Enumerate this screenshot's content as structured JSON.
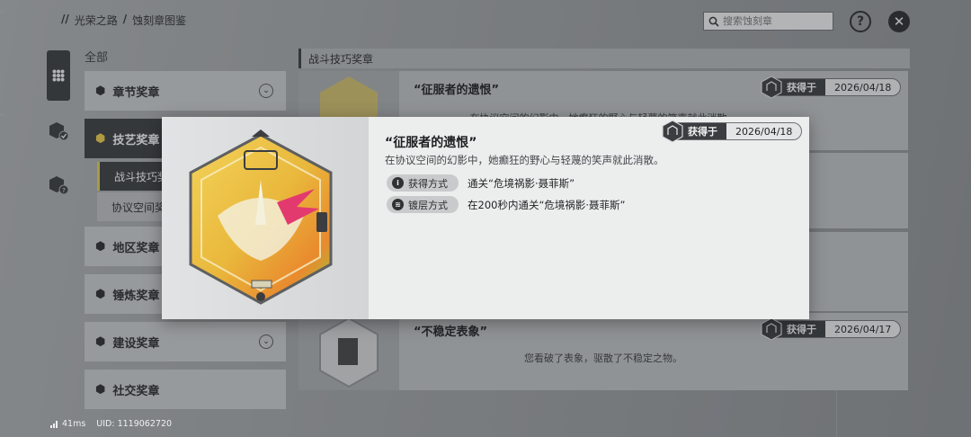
{
  "breadcrumb": {
    "prefix": "//",
    "root": "光荣之路",
    "separator": "/",
    "current": "蚀刻章图鉴"
  },
  "search": {
    "placeholder": "搜索蚀刻章"
  },
  "controls": {
    "help": "?",
    "close": "✕"
  },
  "categories": {
    "all_label": "全部",
    "items": [
      {
        "label": "章节奖章",
        "icon": "chapter-medal-icon",
        "active": false,
        "expandable": true
      },
      {
        "label": "技艺奖章",
        "icon": "skill-medal-icon",
        "active": true,
        "expandable": false
      },
      {
        "label": "地区奖章",
        "icon": "region-medal-icon",
        "active": false,
        "expandable": false
      },
      {
        "label": "锤炼奖章",
        "icon": "temper-medal-icon",
        "active": false,
        "expandable": false
      },
      {
        "label": "建设奖章",
        "icon": "build-medal-icon",
        "active": false,
        "expandable": true
      },
      {
        "label": "社交奖章",
        "icon": "social-medal-icon",
        "active": false,
        "expandable": false
      }
    ],
    "subitems": [
      {
        "label": "战斗技巧奖",
        "active": true
      },
      {
        "label": "协议空间奖",
        "active": false
      }
    ]
  },
  "list": {
    "section_title": "战斗技巧奖章",
    "cards": [
      {
        "title": "“征服者的遗恨”",
        "desc": "在协议空间的幻影中，她癫狂的野心与轻蔑的笑声就此消散。",
        "got_label": "获得于",
        "date": "2026/04/18"
      },
      {
        "title": "“不稳定表象”",
        "desc": "您看破了表象，驱散了不稳定之物。",
        "got_label": "获得于",
        "date": "2026/04/17"
      }
    ]
  },
  "modal": {
    "title": "“征服者的遗恨”",
    "desc": "在协议空间的幻影中，她癫狂的野心与轻蔑的笑声就此消散。",
    "got_label": "获得于",
    "date": "2026/04/18",
    "obtain_label": "获得方式",
    "obtain_value": "通关“危境祸影·聂菲斯”",
    "plating_label": "镀层方式",
    "plating_value": "在200秒内通关“危境祸影·聂菲斯”"
  },
  "footer": {
    "ping": "41ms",
    "uid": "UID: 1119062720"
  },
  "colors": {
    "medal_gold": "#e8c24a",
    "medal_green": "#8fcf3a",
    "medal_orange": "#e8732a",
    "medal_pink": "#e23a6e"
  }
}
